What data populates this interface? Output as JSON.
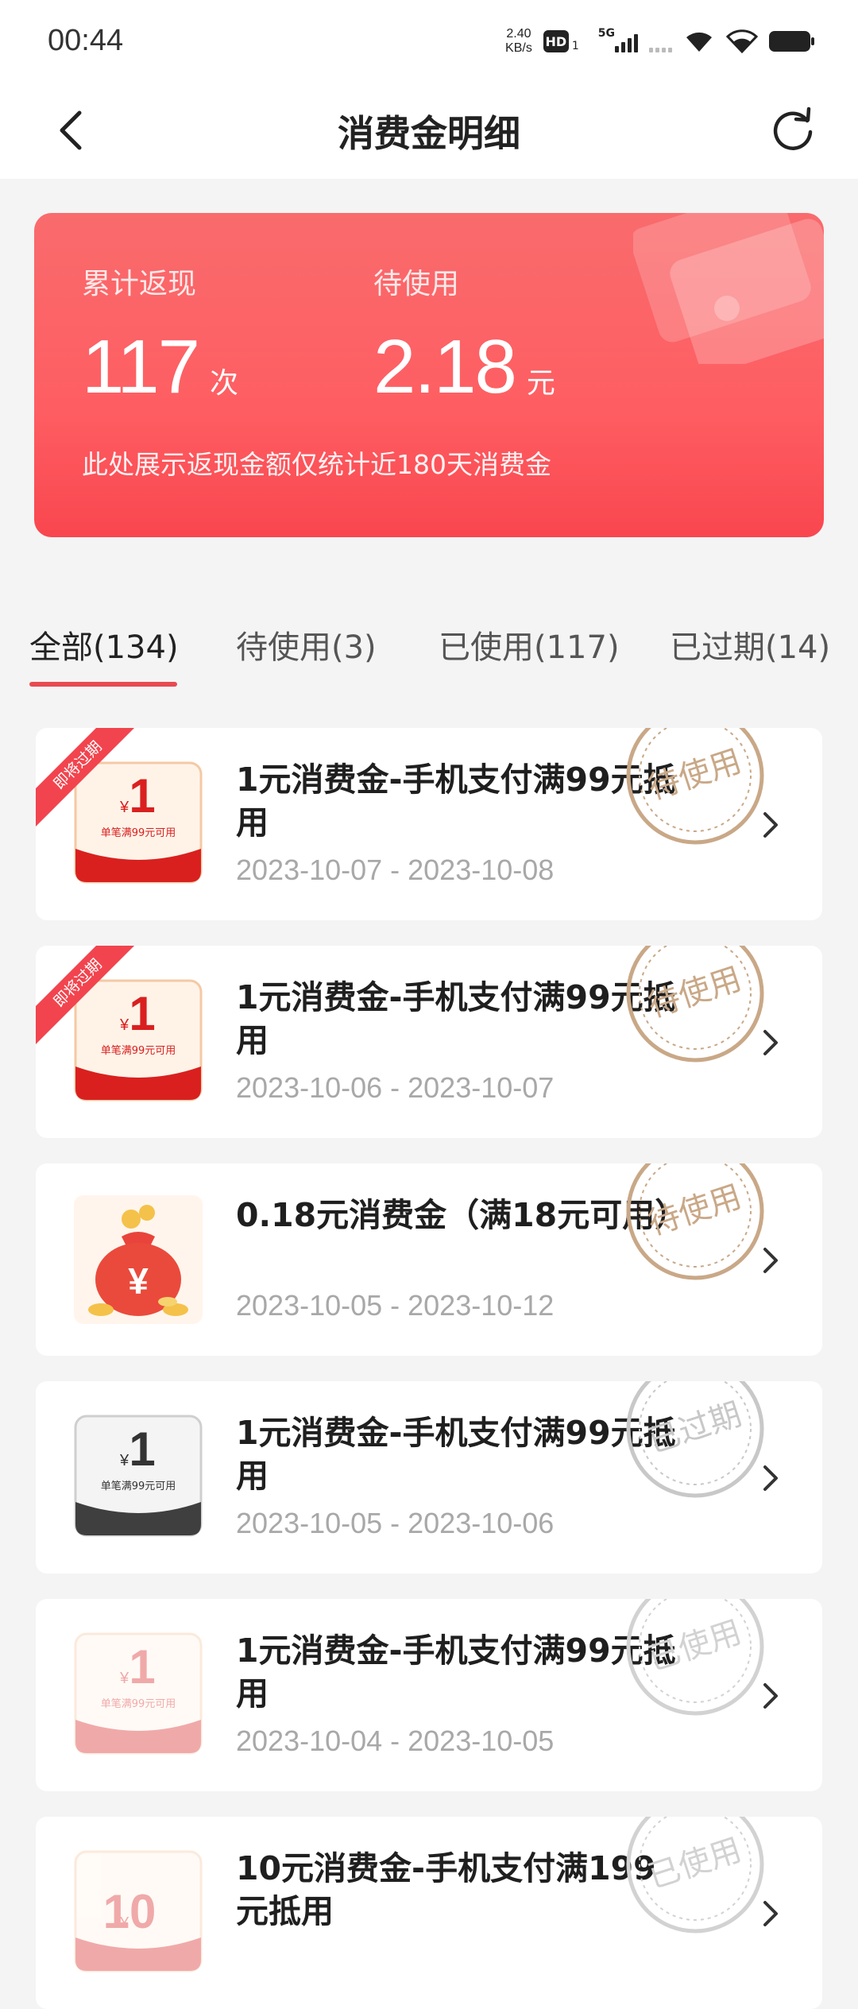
{
  "status": {
    "time": "00:44",
    "net_speed_value": "2.40",
    "net_speed_unit": "KB/s",
    "hd": "HD",
    "sim": "1",
    "network": "5G"
  },
  "header": {
    "title": "消费金明细",
    "back_icon": "back-arrow-icon",
    "refresh_icon": "refresh-icon"
  },
  "summary": {
    "cashback_label": "累计返现",
    "cashback_value": "117",
    "cashback_unit": "次",
    "pending_label": "待使用",
    "pending_value": "2.18",
    "pending_unit": "元",
    "note": "此处展示返现金额仅统计近180天消费金"
  },
  "tabs": [
    {
      "label": "全部(134)",
      "active": true
    },
    {
      "label": "待使用(3)",
      "active": false
    },
    {
      "label": "已使用(117)",
      "active": false
    },
    {
      "label": "已过期(14)",
      "active": false
    }
  ],
  "coupons": [
    {
      "title": "1元消费金-手机支付满99元抵用",
      "date": "2023-10-07 - 2023-10-08",
      "ribbon": "即将过期",
      "stamp": "待使用",
      "amount": "1",
      "cond": "单笔满99元可用",
      "style": "red"
    },
    {
      "title": "1元消费金-手机支付满99元抵用",
      "date": "2023-10-06 - 2023-10-07",
      "ribbon": "即将过期",
      "stamp": "待使用",
      "amount": "1",
      "cond": "单笔满99元可用",
      "style": "red"
    },
    {
      "title": "0.18元消费金（满18元可用）",
      "date": "2023-10-05 - 2023-10-12",
      "ribbon": "",
      "stamp": "待使用",
      "amount": "",
      "cond": "",
      "style": "bag"
    },
    {
      "title": "1元消费金-手机支付满99元抵用",
      "date": "2023-10-05 - 2023-10-06",
      "ribbon": "",
      "stamp": "已过期",
      "amount": "1",
      "cond": "单笔满99元可用",
      "style": "grey"
    },
    {
      "title": "1元消费金-手机支付满99元抵用",
      "date": "2023-10-04 - 2023-10-05",
      "ribbon": "",
      "stamp": "已使用",
      "amount": "1",
      "cond": "单笔满99元可用",
      "style": "faded"
    },
    {
      "title": "10元消费金-手机支付满199元抵用",
      "date": "",
      "ribbon": "",
      "stamp": "已使用",
      "amount": "10",
      "cond": "",
      "style": "faded"
    }
  ],
  "colors": {
    "accent": "#e84a50",
    "card_red": "#fe5e62",
    "stamp_gold": "#c9a887",
    "stamp_grey": "#c8c8c8"
  }
}
